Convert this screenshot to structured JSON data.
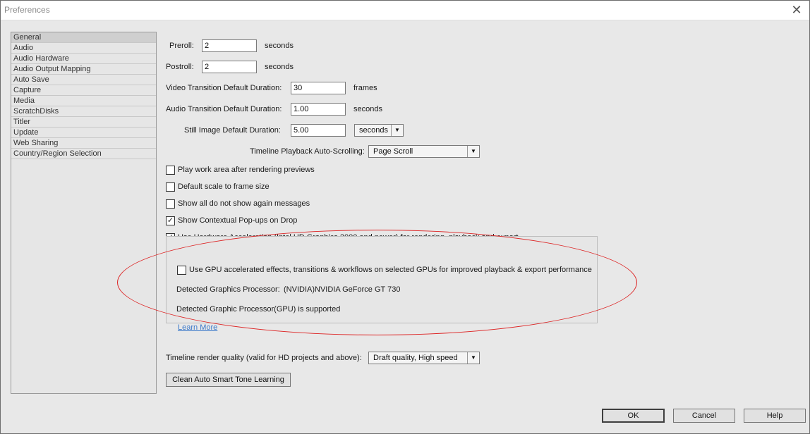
{
  "window": {
    "title": "Preferences",
    "close_glyph": "✕"
  },
  "sidebar": {
    "items": [
      {
        "label": "General"
      },
      {
        "label": "Audio"
      },
      {
        "label": "Audio Hardware"
      },
      {
        "label": "Audio Output Mapping"
      },
      {
        "label": "Auto Save"
      },
      {
        "label": "Capture"
      },
      {
        "label": "Media"
      },
      {
        "label": "ScratchDisks"
      },
      {
        "label": "Titler"
      },
      {
        "label": "Update"
      },
      {
        "label": "Web Sharing"
      },
      {
        "label": "Country/Region Selection"
      }
    ],
    "selected": "General"
  },
  "form": {
    "preroll": {
      "label": "Preroll:",
      "value": "2",
      "unit": "seconds"
    },
    "postroll": {
      "label": "Postroll:",
      "value": "2",
      "unit": "seconds"
    },
    "video_transition": {
      "label": "Video Transition Default Duration:",
      "value": "30",
      "unit": "frames"
    },
    "audio_transition": {
      "label": "Audio Transition Default Duration:",
      "value": "1.00",
      "unit": "seconds"
    },
    "still_image": {
      "label": "Still Image Default Duration:",
      "value": "5.00",
      "unit_select": "seconds"
    },
    "timeline_scroll": {
      "label": "Timeline Playback Auto-Scrolling:",
      "value": "Page Scroll"
    },
    "checkboxes": {
      "play_work_area": {
        "label": "Play work area after rendering previews",
        "checked": false
      },
      "default_scale": {
        "label": "Default scale to frame size",
        "checked": false
      },
      "show_all": {
        "label": "Show all do not show again messages",
        "checked": false
      },
      "contextual_popups": {
        "label": "Show Contextual Pop-ups on Drop",
        "checked": true
      },
      "hardware_accel": {
        "label": "Use Hardware Acceleration (Intel HD Graphics 2000 and newer) for rendering, playback and export",
        "checked": true
      }
    },
    "gpu": {
      "checkbox_label": "Use GPU accelerated effects, transitions & workflows on selected GPUs for improved playback & export performance",
      "checked": false,
      "detected_label": "Detected Graphics Processor:",
      "detected_value": "(NVIDIA)NVIDIA GeForce GT 730",
      "supported_text": "Detected Graphic Processor(GPU) is supported",
      "learn_more": "Learn More"
    },
    "render_quality": {
      "label": "Timeline render quality (valid for HD projects and above):",
      "value": "Draft quality, High speed"
    },
    "clean_button": "Clean Auto Smart Tone Learning"
  },
  "footer": {
    "ok": "OK",
    "cancel": "Cancel",
    "help": "Help"
  },
  "colors": {
    "annotation": "#dd2222",
    "link": "#3a78c9"
  },
  "icons": {
    "checkmark": "✓",
    "dropdown": "▼"
  }
}
